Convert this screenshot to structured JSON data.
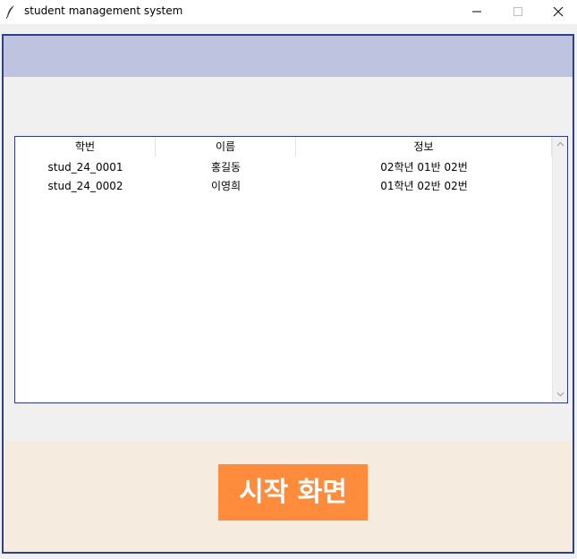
{
  "window": {
    "title": "student management system",
    "icon": "feather-icon",
    "controls": [
      "minimize-icon",
      "maximize-icon",
      "close-icon"
    ]
  },
  "colors": {
    "frame_border": "#2f3f8f",
    "top_band": "#bec4e0",
    "bottom_band": "#f5ebdf",
    "start_button": "#ff8b3d",
    "background": "#f0f0f0"
  },
  "table": {
    "columns": [
      "학번",
      "이름",
      "정보"
    ],
    "rows": [
      [
        "stud_24_0001",
        "홍길동",
        "02학년 01반 02번"
      ],
      [
        "stud_24_0002",
        "이영희",
        "01학년 02반 02번"
      ]
    ]
  },
  "start_button": {
    "label": "시작 화면"
  }
}
